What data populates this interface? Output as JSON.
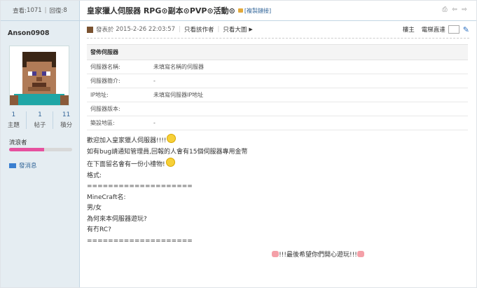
{
  "sidebar": {
    "views_label": "查看:",
    "views": "1071",
    "replies_label": "回復:",
    "replies": "8",
    "username": "Anson0908",
    "stats": [
      {
        "value": "1",
        "label": "主題"
      },
      {
        "value": "1",
        "label": "帖子"
      },
      {
        "value": "11",
        "label": "積分"
      }
    ],
    "rank": "流浪者",
    "rank_progress": 0.55,
    "send_message": "發消息"
  },
  "thread": {
    "title": "皇家獵人伺服器 RPG⊙副本⊙PVP⊙活動⊙",
    "copy_link": "[複製鏈接]"
  },
  "post": {
    "posted_prefix": "發表於",
    "posted_time": "2015-2-26 22:03:57",
    "only_author": "只看該作者",
    "big_image": "只看大圖",
    "floor": "樓主",
    "jump_label": "電梯直達"
  },
  "server_table": {
    "header": "發佈伺服器",
    "rows": [
      {
        "key": "伺服器名稱:",
        "value": "未填寫名稱的伺服器"
      },
      {
        "key": "伺服器簡介:",
        "value": "-"
      },
      {
        "key": "IP地址:",
        "value": "未填寫伺服器IP地址"
      },
      {
        "key": "伺服器版本:",
        "value": ""
      },
      {
        "key": "築設地區:",
        "value": "-"
      }
    ]
  },
  "content": {
    "line1": "歡迎加入皇家獵人伺服器!!!!",
    "line2": "如有bug請通知管理員,回報的人會有15個伺服器專用金幣",
    "line3": "在下面留名會有一份小禮物!",
    "line4": "格式:",
    "line5": "====================",
    "line6": "MineCraft名:",
    "line7": "男/女",
    "line8": "為何來本伺服器遊玩?",
    "line9": "有冇RC?",
    "line10": "====================",
    "closing": "!!!最後希望你們開心遊玩!!!"
  }
}
